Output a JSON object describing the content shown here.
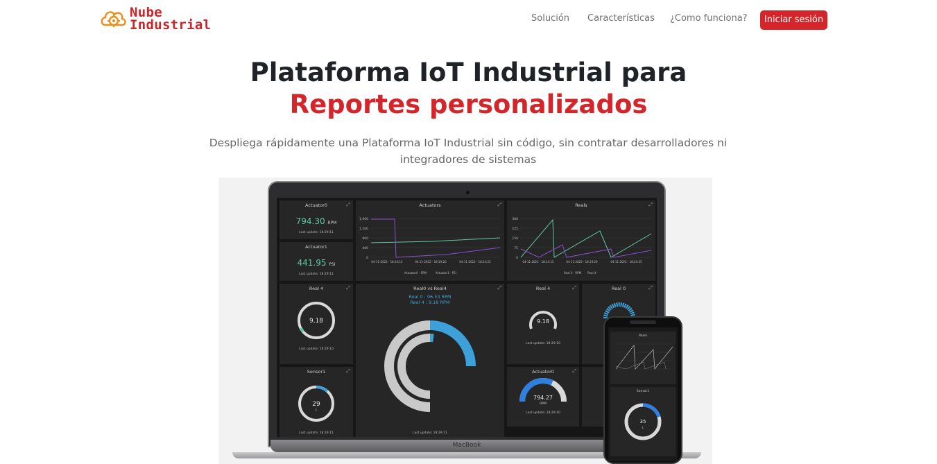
{
  "logo": {
    "line1": "Nube",
    "line2": "Industrial",
    "color": "#c8262a"
  },
  "nav": {
    "links": [
      "Solución",
      "Características",
      "¿Como funciona?"
    ],
    "login_label": "Iniciar sesión"
  },
  "hero": {
    "title_line1": "Plataforma IoT Industrial para",
    "title_line2": "Reportes personalizados",
    "subtitle": "Despliega rápidamente una Plataforma IoT Industrial sin código, sin contratar desarrolladores ni integradores de sistemas"
  },
  "colors": {
    "brand_red": "#d4252a",
    "teal": "#61c9a2",
    "purple": "#7b4fc9",
    "blue": "#3da0d8"
  },
  "dashboard": {
    "actuator0": {
      "title": "Actuator0",
      "value": "794.30",
      "unit": "RPM",
      "updated": "Last update: 18:29:11"
    },
    "actuator1": {
      "title": "Actuator1",
      "value": "441.95",
      "unit": "PSI",
      "updated": "Last update: 18:29:11"
    },
    "actuators_chart": {
      "title": "Actuators",
      "y_ticks": [
        "1,600",
        "1,200",
        "800",
        "400",
        "0"
      ],
      "x_ticks": [
        "04-11-2022 - 18:14:15",
        "04-11-2022 - 18:19:20",
        "04-11-2022 - 18:24:25"
      ],
      "legend": [
        "Actuator0 - RPM",
        "Actuator1 - PSI"
      ]
    },
    "reals_chart": {
      "title": "Reals",
      "y_ticks": [
        "300",
        "225",
        "150",
        "75",
        "0"
      ],
      "x_ticks": [
        "04-11-2022 - 18:14:15",
        "04-11-2022 - 18:19:20",
        "04-11-2022 - 18:24:25"
      ],
      "legend": [
        "Real 0 - RPM",
        "Real 4 -"
      ]
    },
    "real4_left": {
      "title": "Real 4",
      "value": "9.18",
      "updated": "Last update: 18:29:10",
      "level": 0.04
    },
    "real0_vs_real4": {
      "title": "Real0 vs Real4",
      "line1": "Real 0 : 96.53 RPM",
      "line2": "Real 4 : 9.18 RPM",
      "updated": "Last update: 18:29:11"
    },
    "real4_right": {
      "title": "Real 4",
      "value": "9.18",
      "updated": "Last update: 18:29:10"
    },
    "real0": {
      "title": "Real 0"
    },
    "sensor1": {
      "title": "Sensor1",
      "value": "29",
      "unit": "L",
      "updated": "Last update: 18:29:11"
    },
    "actuator0_gauge": {
      "title": "Actuator0",
      "value": "794.27",
      "unit": "RPM",
      "updated": "Last update: 18:29:10"
    },
    "laptop_brand": "MacBook"
  },
  "phone": {
    "reals_title": "Reals",
    "sensor_title": "Sensor1",
    "sensor_value": "35",
    "sensor_unit": "L"
  }
}
